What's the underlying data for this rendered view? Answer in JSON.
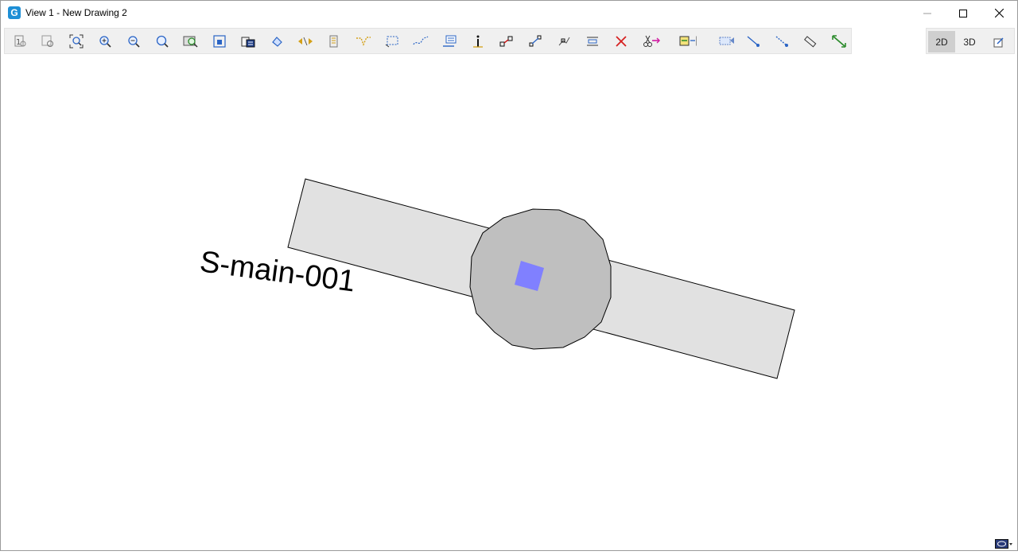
{
  "window": {
    "title": "View 1 - New Drawing 2",
    "app_icon_glyph": "G"
  },
  "toolbar": {
    "icons": [
      "fit-view-icon",
      "zoom-previous-icon",
      "zoom-extents-icon",
      "zoom-in-icon",
      "zoom-out-icon",
      "zoom-window-icon",
      "zoom-selection-icon",
      "zoom-center-icon",
      "layers-icon",
      "fill-icon",
      "pan-icon",
      "properties-icon",
      "select-polyline-icon",
      "select-rectangle-icon",
      "select-freehand-icon",
      "select-list-icon",
      "info-icon",
      "connect-icon",
      "node-edit-icon",
      "vertex-move-icon",
      "align-icon",
      "delete-icon",
      "cut-icon",
      "copy-move-icon",
      "transform-icon",
      "trace-line-icon",
      "measure-line-icon",
      "ruler-icon",
      "measure-distance-icon"
    ]
  },
  "viewmode": {
    "btn_2d": "2D",
    "btn_3d": "3D",
    "active": "2D"
  },
  "drawing": {
    "label_text": "S-main-001",
    "colors": {
      "pipe_fill": "#e1e1e1",
      "manhole_fill": "#bfbfbf",
      "node_fill": "#8080ff",
      "stroke": "#000000"
    }
  }
}
